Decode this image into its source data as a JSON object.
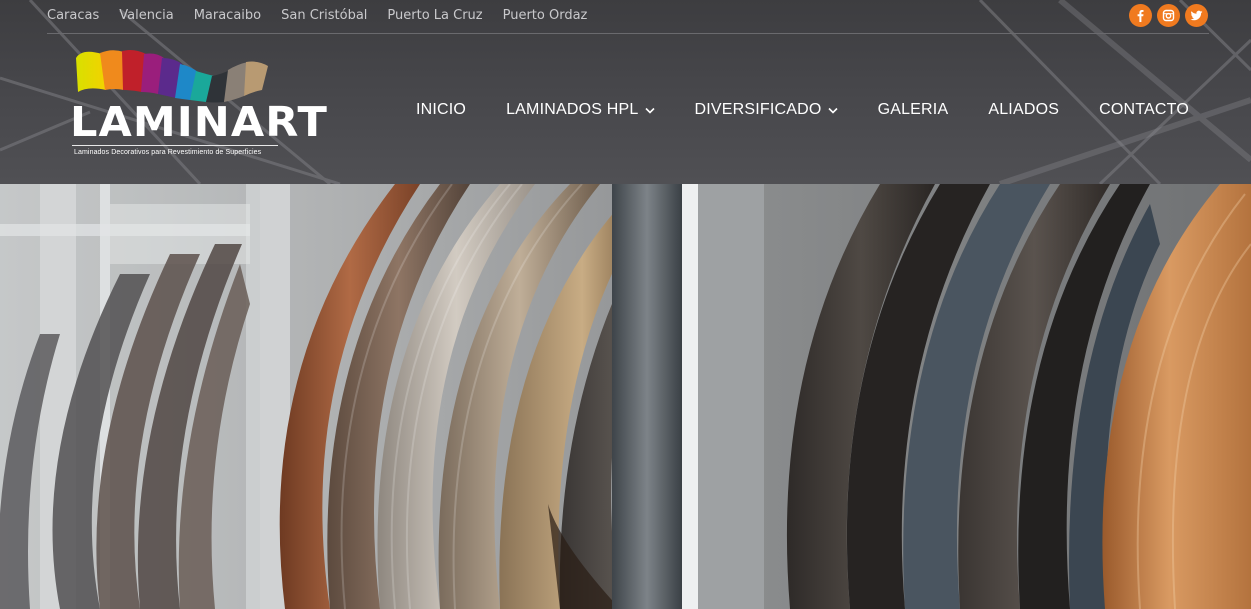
{
  "topbar": {
    "cities": [
      "Caracas",
      "Valencia",
      "Maracaibo",
      "San Cristóbal",
      "Puerto La Cruz",
      "Puerto Ordaz"
    ],
    "socials": [
      {
        "name": "facebook-icon",
        "glyph": "f"
      },
      {
        "name": "instagram-icon",
        "glyph": "instagram"
      },
      {
        "name": "twitter-icon",
        "glyph": "twitter"
      }
    ],
    "social_color": "#f07a1f"
  },
  "logo": {
    "name": "LAMINART",
    "tagline": "Laminados Decorativos para Revestimiento de Superficies"
  },
  "nav": {
    "items": [
      {
        "label": "INICIO",
        "has_dropdown": false
      },
      {
        "label": "LAMINADOS HPL",
        "has_dropdown": true
      },
      {
        "label": "DIVERSIFICADO",
        "has_dropdown": true
      },
      {
        "label": "GALERIA",
        "has_dropdown": false
      },
      {
        "label": "ALIADOS",
        "has_dropdown": false
      },
      {
        "label": "CONTACTO",
        "has_dropdown": false
      }
    ]
  },
  "hero": {
    "image_subject": "rolls of wood-veneer edge banding"
  }
}
